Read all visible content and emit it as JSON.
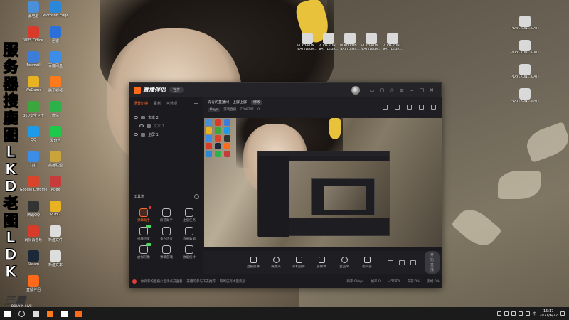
{
  "desktop": {
    "left_icons": [
      {
        "label": "此电脑",
        "color": "#4a90d9"
      },
      {
        "label": "WPS Office",
        "color": "#d93b2b"
      },
      {
        "label": "Foxmail",
        "color": "#3b7dd9"
      },
      {
        "label": "WeGame",
        "color": "#e8b322"
      },
      {
        "label": "360安全卫士",
        "color": "#3ba63b"
      },
      {
        "label": "QQ",
        "color": "#1e9be8"
      },
      {
        "label": "钉钉",
        "color": "#3b8de8"
      },
      {
        "label": "Google Chrome",
        "color": "#d9442b"
      },
      {
        "label": "腾讯QQ",
        "color": "#333333"
      },
      {
        "label": "网易云音乐",
        "color": "#d93b2b"
      },
      {
        "label": "Steam",
        "color": "#1b2838"
      },
      {
        "label": "直播伴侣",
        "color": "#ff6a1a"
      }
    ],
    "second_column": [
      {
        "label": "Microsoft Edge",
        "color": "#2b88d9"
      },
      {
        "label": "迅雷",
        "color": "#2b6fd9"
      },
      {
        "label": "百度网盘",
        "color": "#3b8de8"
      },
      {
        "label": "腾讯视频",
        "color": "#ff7a1a"
      },
      {
        "label": "微信",
        "color": "#2bb34a"
      },
      {
        "label": "爱奇艺",
        "color": "#1ec84b"
      },
      {
        "label": "英雄联盟",
        "color": "#c8a43a"
      },
      {
        "label": "Apex",
        "color": "#c83b3b"
      },
      {
        "label": "PUBG",
        "color": "#e8b322"
      },
      {
        "label": "新建文件",
        "color": "#dddddd"
      },
      {
        "label": "新建文本",
        "color": "#dddddd"
      }
    ],
    "top_right_pubg": [
      "PLAYERUN...",
      "PLAYERUN...",
      "PLAYERUN...",
      "PLAYERUN...",
      "PLAYERUN..."
    ],
    "top_right_pubg_sub": "BATTLEGR...",
    "right_column": [
      "PLAYERUN... BATTLEGR...",
      "PLAYERUN... BATTLEGR...",
      "PLAYERUN... BATTLEGR...",
      "PLAYERUN... BATTLEGR..."
    ],
    "watermark_chars": [
      "服",
      "务",
      "器",
      "搜",
      "鹿",
      "图",
      "L",
      "K",
      "D",
      "老",
      "图",
      "L",
      "D",
      "K"
    ],
    "corner_logo": "三屋",
    "corner_logo_sub": "DOUYIN LIVE"
  },
  "app": {
    "name": "直播伴侣",
    "version_badge": "官方",
    "sidebar": {
      "tabs": [
        "场景切换",
        "素材",
        "可选项"
      ],
      "add_symbol": "+",
      "scenes": [
        {
          "name": "文本 2",
          "sub": false
        },
        {
          "name": "文本 1",
          "sub": true
        },
        {
          "name": "全屏 1",
          "sub": false
        }
      ],
      "toolbox_title": "工具箱",
      "tools": [
        {
          "label": "弹幕助手",
          "active": true,
          "badge": "red"
        },
        {
          "label": "房管助手",
          "active": false,
          "badge": ""
        },
        {
          "label": "主播任务",
          "active": false,
          "badge": ""
        },
        {
          "label": "视频连麦",
          "active": false,
          "badge": "green"
        },
        {
          "label": "多人连麦",
          "active": false,
          "badge": ""
        },
        {
          "label": "直播数据",
          "active": false,
          "badge": ""
        },
        {
          "label": "虚拟形象",
          "active": false,
          "badge": "green"
        },
        {
          "label": "弹幕游戏",
          "active": false,
          "badge": ""
        },
        {
          "label": "数据统计",
          "active": false,
          "badge": ""
        }
      ]
    },
    "room": {
      "title": "青青的直播间！上屏上屏",
      "edit": "修改",
      "category": "Days",
      "meta1": "游戏直播",
      "meta2": "7708201",
      "viewers": "0"
    },
    "bottom_actions": [
      {
        "label": "直播屏幕"
      },
      {
        "label": "摄像头"
      },
      {
        "label": "手机投屏"
      },
      {
        "label": "多媒体"
      },
      {
        "label": "麦克风"
      },
      {
        "label": "扬声器"
      }
    ],
    "start_live": "开始直播",
    "status": {
      "text1": "你有新的直播公告请点开查看",
      "text2": "开播可参与下去推荐",
      "text3": "每周还有大量奖励",
      "stats": [
        "码率:0kbps",
        "帧率:0",
        "CPU:0%",
        "内存:0%",
        "丢帧:0%"
      ]
    }
  },
  "taskbar": {
    "time": "15:17",
    "date": "2021/6/22",
    "lang": "中",
    "icons": [
      {
        "name": "start",
        "color": "#ffffff"
      },
      {
        "name": "search",
        "color": "#dddddd"
      },
      {
        "name": "task-view",
        "color": "#dddddd"
      },
      {
        "name": "firefox",
        "color": "#ff7a1a"
      },
      {
        "name": "feishu",
        "color": "#ffffff"
      },
      {
        "name": "livecompanion",
        "color": "#ff6a1a"
      }
    ]
  }
}
